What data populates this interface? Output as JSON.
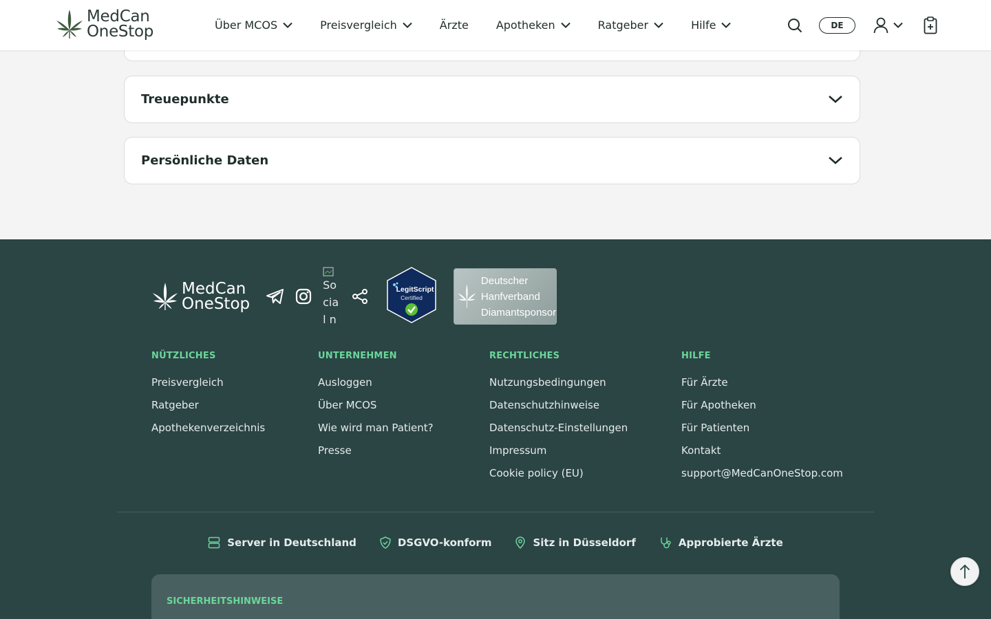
{
  "header": {
    "logo_line1": "MedCan",
    "logo_line2": "OneStop",
    "nav": [
      {
        "label": "Über MCOS",
        "has_dropdown": true
      },
      {
        "label": "Preisvergleich",
        "has_dropdown": true
      },
      {
        "label": "Ärzte",
        "has_dropdown": false
      },
      {
        "label": "Apotheken",
        "has_dropdown": true
      },
      {
        "label": "Ratgeber",
        "has_dropdown": true
      },
      {
        "label": "Hilfe",
        "has_dropdown": true
      }
    ],
    "lang": "DE",
    "icons": [
      "search-icon",
      "user-icon",
      "clipboard-icon"
    ]
  },
  "accordions": [
    {
      "title": "Treuepunkte"
    },
    {
      "title": "Persönliche Daten"
    }
  ],
  "footer": {
    "logo_line1": "MedCan",
    "logo_line2": "OneStop",
    "broken_image_alt": "Social network icon",
    "badges": {
      "legitscript_line1": "LegitScript",
      "legitscript_line2": "Certified",
      "dhv_line1": "Deutscher",
      "dhv_line2": "Hanfverband",
      "dhv_line3": "Diamantsponsor"
    },
    "columns": [
      {
        "heading": "NÜTZLICHES",
        "links": [
          "Preisvergleich",
          "Ratgeber",
          "Apothekenverzeichnis"
        ]
      },
      {
        "heading": "UNTERNEHMEN",
        "links": [
          "Ausloggen",
          "Über MCOS",
          "Wie wird man Patient?",
          "Presse"
        ]
      },
      {
        "heading": "RECHTLICHES",
        "links": [
          "Nutzungsbedingungen",
          "Datenschutzhinweise",
          "Datenschutz-Einstellungen",
          "Impressum",
          "Cookie policy (EU)"
        ]
      },
      {
        "heading": "HILFE",
        "links": [
          "Für Ärzte",
          "Für Apotheken",
          "Für Patienten",
          "Kontakt",
          "support@MedCanOneStop.com"
        ]
      }
    ],
    "trust": [
      {
        "label": "Server in Deutschland",
        "icon": "server-icon"
      },
      {
        "label": "DSGVO-konform",
        "icon": "shield-check-icon"
      },
      {
        "label": "Sitz in Düsseldorf",
        "icon": "location-pin-icon"
      },
      {
        "label": "Approbierte Ärzte",
        "icon": "stethoscope-icon"
      }
    ],
    "safety_heading": "SICHERHEITSHINWEISE"
  },
  "colors": {
    "footer_bg": "#2b4444",
    "accent_green": "#6bd69b",
    "header_bg": "#ffffff",
    "page_bg": "#f4f4f4"
  }
}
